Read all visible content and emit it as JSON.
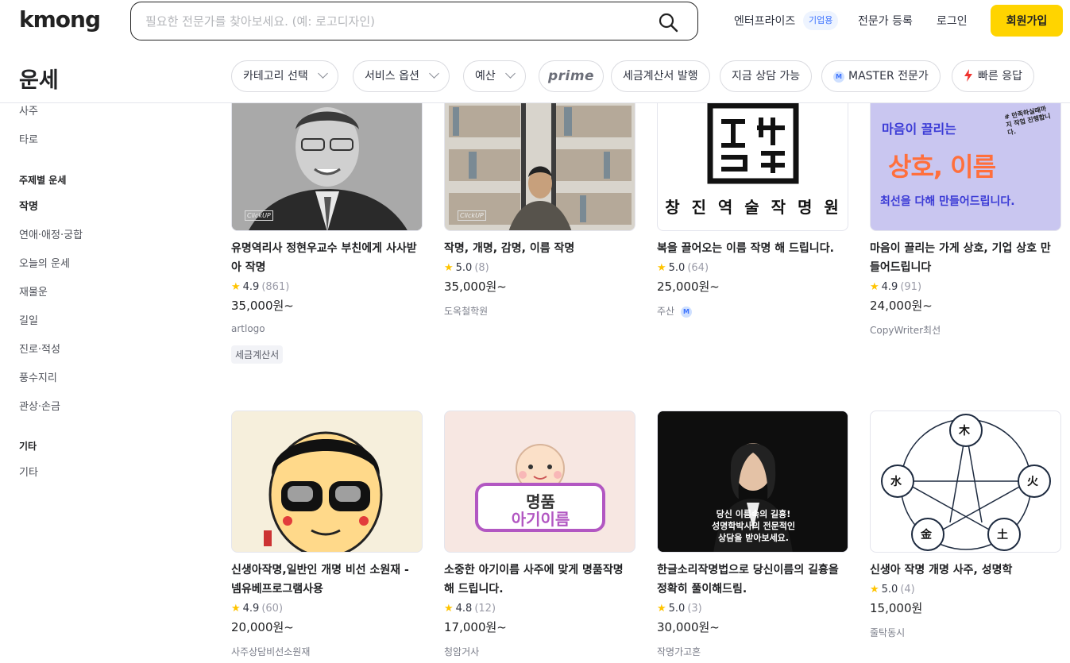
{
  "header": {
    "logo": "kmong",
    "search_placeholder": "필요한 전문가를 찾아보세요. (예: 로고디자인)",
    "enterprise": "엔터프라이즈",
    "enterprise_badge": "기업용",
    "become_expert": "전문가 등록",
    "login": "로그인",
    "signup": "회원가입"
  },
  "page_title": "운세",
  "filters": {
    "category": "카테고리 선택",
    "service_option": "서비스 옵션",
    "budget": "예산",
    "prime": "prime",
    "tax_invoice": "세금계산서 발행",
    "consult_now": "지금 상담 가능",
    "master_badge": "M",
    "master": "MASTER 전문가",
    "fast_response": "빠른 응답"
  },
  "sidebar": {
    "items_top": [
      "사주",
      "타로"
    ],
    "topic_heading": "주제별 운세",
    "topic_items": [
      "작명",
      "연애·애정·궁합",
      "오늘의 운세",
      "재물운",
      "길일",
      "진로·적성",
      "풍수지리",
      "관상·손금"
    ],
    "other_heading": "기타",
    "other_items": [
      "기타"
    ]
  },
  "cards": [
    {
      "title": "유명역리사 정현우교수 부친에게 사사받아 작명",
      "rating": "4.9",
      "count": "(861)",
      "price": "35,000원~",
      "seller": "artlogo",
      "tag": "세금계산서",
      "img_caption": "ClickUP"
    },
    {
      "title": "작명, 개명, 감명, 이름 작명",
      "rating": "5.0",
      "count": "(8)",
      "price": "35,000원~",
      "seller": "도옥철학원",
      "img_caption": "ClickUP"
    },
    {
      "title": "복을 끌어오는 이름 작명 해 드립니다.",
      "rating": "5.0",
      "count": "(64)",
      "price": "25,000원~",
      "seller": "주산",
      "img_caption": "창 진 역 술 작 명 원"
    },
    {
      "title": "마음이 끌리는 가게 상호, 기업 상호 만들어드립니다",
      "rating": "4.9",
      "count": "(91)",
      "price": "24,000원~",
      "seller": "CopyWriter최선",
      "img_line1": "마음이 끌리는",
      "img_line2": "상호, 이름",
      "img_line3": "최선을 다해 만들어드립니다.",
      "img_note": "# 만족하실때까지 작업 진행합니다."
    },
    {
      "title": "신생아작명,일반인 개명 비선 소원재 - 넴유베프로그램사용",
      "rating": "4.9",
      "count": "(60)",
      "price": "20,000원~",
      "seller": "사주상담비선소원재"
    },
    {
      "title": "소중한 아기이름 사주에 맞게 명품작명 해 드립니다.",
      "rating": "4.8",
      "count": "(12)",
      "price": "17,000원~",
      "seller": "청암거사",
      "img_line1": "명품",
      "img_line2": "아기이름"
    },
    {
      "title": "한글소리작명법으로 당신이름의 길흉을 정확히 풀이해드림.",
      "rating": "5.0",
      "count": "(3)",
      "price": "30,000원~",
      "seller": "작명가고흔",
      "img_line1": "당신 이름속의 길흉!",
      "img_line2": "성명학박사의 전문적인",
      "img_line3": "상담을 받아보세요."
    },
    {
      "title": "신생아 작명 개명 사주, 성명학",
      "rating": "5.0",
      "count": "(4)",
      "price": "15,000원",
      "seller": "줄탁동시",
      "elements": [
        "木",
        "火",
        "土",
        "金",
        "水"
      ]
    }
  ]
}
